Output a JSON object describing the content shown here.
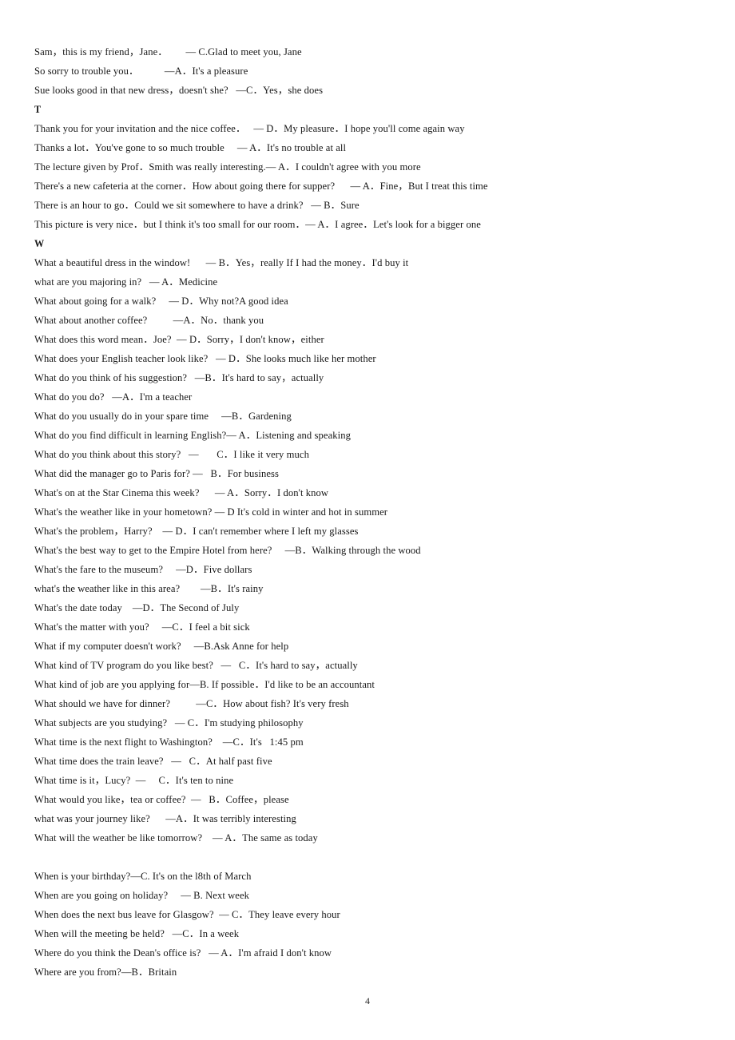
{
  "document": {
    "page_number": "4",
    "lines": [
      {
        "type": "entry",
        "text": "Sam，this is my friend，Jane．       — C.Glad to meet you, Jane"
      },
      {
        "type": "entry",
        "text": "So sorry to trouble you．          —A．It's a pleasure"
      },
      {
        "type": "entry",
        "text": "Sue looks good in that new dress，doesn't she?   —C．Yes，she does"
      },
      {
        "type": "section",
        "text": "T"
      },
      {
        "type": "entry",
        "text": "Thank you for your invitation and the nice coffee．   — D．My pleasure．I hope you'll come again way"
      },
      {
        "type": "entry",
        "text": "Thanks a lot．You've gone to so much trouble     — A．It's no trouble at all"
      },
      {
        "type": "entry",
        "text": "The lecture given by Prof．Smith was really interesting.— A．I couldn't agree with you more"
      },
      {
        "type": "entry",
        "text": "There's a new cafeteria at the corner．How about going there for supper?      — A．Fine，But I treat this time"
      },
      {
        "type": "entry",
        "text": "There is an hour to go．Could we sit somewhere to have a drink?   — B．Sure"
      },
      {
        "type": "entry",
        "text": "This picture is very nice．but I think it's too small for our room．— A．I agree．Let's look for a bigger one"
      },
      {
        "type": "section",
        "text": "W"
      },
      {
        "type": "entry",
        "text": "What a beautiful dress in the window!      — B．Yes，really If I had the money．I'd buy it"
      },
      {
        "type": "entry",
        "text": "what are you majoring in?   — A．Medicine"
      },
      {
        "type": "entry",
        "text": "What about going for a walk?     — D．Why not?A good idea"
      },
      {
        "type": "entry",
        "text": "What about another coffee?          —A．No．thank you"
      },
      {
        "type": "entry",
        "text": "What does this word mean．Joe?  — D．Sorry，I don't know，either"
      },
      {
        "type": "entry",
        "text": "What does your English teacher look like?   — D．She looks much like her mother"
      },
      {
        "type": "entry",
        "text": "What do you think of his suggestion?   —B．It's hard to say，actually"
      },
      {
        "type": "entry",
        "text": "What do you do?   —A．I'm a teacher"
      },
      {
        "type": "entry",
        "text": "What do you usually do in your spare time     —B．Gardening"
      },
      {
        "type": "entry",
        "text": "What do you find difficult in learning English?— A．Listening and speaking"
      },
      {
        "type": "entry",
        "text": "What do you think about this story?   —       C．I like it very much"
      },
      {
        "type": "entry",
        "text": "What did the manager go to Paris for? —   B．For business"
      },
      {
        "type": "entry",
        "text": "What's on at the Star Cinema this week?      — A．Sorry．I don't know"
      },
      {
        "type": "entry",
        "text": "What's the weather like in your hometown? — D It's cold in winter and hot in summer"
      },
      {
        "type": "entry",
        "text": "What's the problem，Harry?    — D．I can't remember where I left my glasses"
      },
      {
        "type": "entry",
        "text": "What's the best way to get to the Empire Hotel from here?     —B．Walking through the wood"
      },
      {
        "type": "entry",
        "text": "What's the fare to the museum?     —D．Five dollars"
      },
      {
        "type": "entry",
        "text": "what's the weather like in this area?        —B．It's rainy"
      },
      {
        "type": "entry",
        "text": "What's the date today    —D．The Second of July"
      },
      {
        "type": "entry",
        "text": "What's the matter with you?     —C．I feel a bit sick"
      },
      {
        "type": "entry",
        "text": "What if my computer doesn't work?     —B.Ask Anne for help"
      },
      {
        "type": "entry",
        "text": "What kind of TV program do you like best?   —   C．It's hard to say，actually"
      },
      {
        "type": "entry",
        "text": "What kind of job are you applying for—B. If possible．I'd like to be an accountant"
      },
      {
        "type": "entry",
        "text": "What should we have for dinner?          —C．How about fish? It's very fresh"
      },
      {
        "type": "entry",
        "text": "What subjects are you studying?   — C．I'm studying philosophy"
      },
      {
        "type": "entry",
        "text": "What time is the next flight to Washington?    —C．It's   1:45 pm"
      },
      {
        "type": "entry",
        "text": "What time does the train leave?   —   C．At half past five"
      },
      {
        "type": "entry",
        "text": "What time is it，Lucy?  —     C．It's ten to nine"
      },
      {
        "type": "entry",
        "text": "What would you like，tea or coffee?  —   B．Coffee，please"
      },
      {
        "type": "entry",
        "text": "what was your journey like?      —A．It was terribly interesting"
      },
      {
        "type": "entry",
        "text": "What will the weather be like tomorrow?    — A．The same as today"
      },
      {
        "type": "blank",
        "text": ""
      },
      {
        "type": "entry",
        "text": "When is your birthday?—C. It's on the l8th of March"
      },
      {
        "type": "entry",
        "text": "When are you going on holiday?     — B. Next week"
      },
      {
        "type": "entry",
        "text": "When does the next bus leave for Glasgow?  — C．They leave every hour"
      },
      {
        "type": "entry",
        "text": "When will the meeting be held?   —C．In a week"
      },
      {
        "type": "entry",
        "text": "Where do you think the Dean's office is?   — A．I'm afraid I don't know"
      },
      {
        "type": "entry",
        "text": "Where are you from?—B．Britain"
      }
    ]
  }
}
